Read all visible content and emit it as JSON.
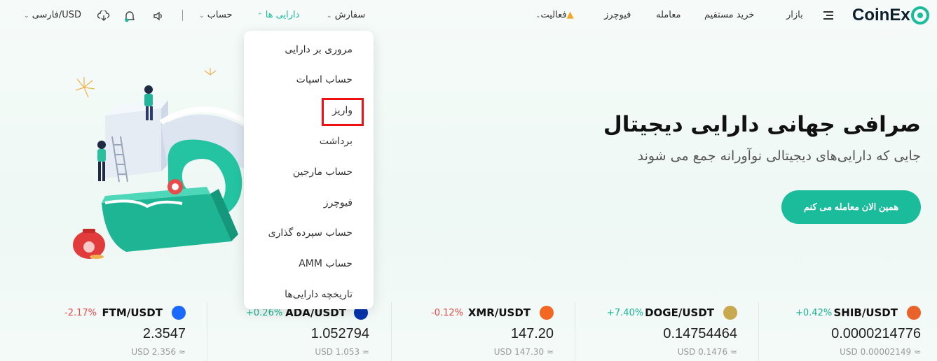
{
  "header": {
    "brand": "CoinEx",
    "nav": {
      "market": "بازار",
      "direct_buy": "خرید مستقیم",
      "trade": "معامله",
      "futures": "فیوچرز",
      "activity": "فعالیت"
    },
    "right": {
      "orders": "سفارش",
      "assets": "دارایی ها",
      "account": "حساب",
      "language_currency": "فارسی/USD"
    }
  },
  "assets_menu": {
    "items": [
      "مروری بر دارایی",
      "حساب اسپات",
      "واریز",
      "برداشت",
      "حساب مارجین",
      "فیوچرز",
      "حساب سپرده گذاری",
      "حساب AMM",
      "تاریخچه دارایی‌ها"
    ],
    "highlighted_index": 2
  },
  "hero": {
    "title": "صرافی جهانی دارایی دیجیتال",
    "subtitle": "جایی که دارایی‌های دیجیتالی نوآورانه جمع می شوند",
    "cta": "همین الان معامله می کنم"
  },
  "tickers": [
    {
      "pair": "SHIB/USDT",
      "change": "+0.42%",
      "price": "0.0000214776",
      "usd": "USD 0.00002149 ≈",
      "dir": "up",
      "icon": "shib-icon",
      "color": "#e8622a"
    },
    {
      "pair": "DOGE/USDT",
      "change": "+7.40%",
      "price": "0.14754464",
      "usd": "USD 0.1476 ≈",
      "dir": "up",
      "icon": "doge-icon",
      "color": "#c9a94f"
    },
    {
      "pair": "XMR/USDT",
      "change": "-0.12%",
      "price": "147.20",
      "usd": "USD 147.30 ≈",
      "dir": "down",
      "icon": "xmr-icon",
      "color": "#f26822"
    },
    {
      "pair": "ADA/USDT",
      "change": "+0.26%",
      "price": "1.052794",
      "usd": "USD 1.053 ≈",
      "dir": "up",
      "icon": "ada-icon",
      "color": "#0033ad"
    },
    {
      "pair": "FTM/USDT",
      "change": "-2.17%",
      "price": "2.3547",
      "usd": "USD 2.356 ≈",
      "dir": "down",
      "icon": "ftm-icon",
      "color": "#1969ff"
    }
  ],
  "colors": {
    "accent": "#1abc9c",
    "up": "#1ab394",
    "down": "#e84a4a",
    "highlight_box": "#ee1111"
  }
}
